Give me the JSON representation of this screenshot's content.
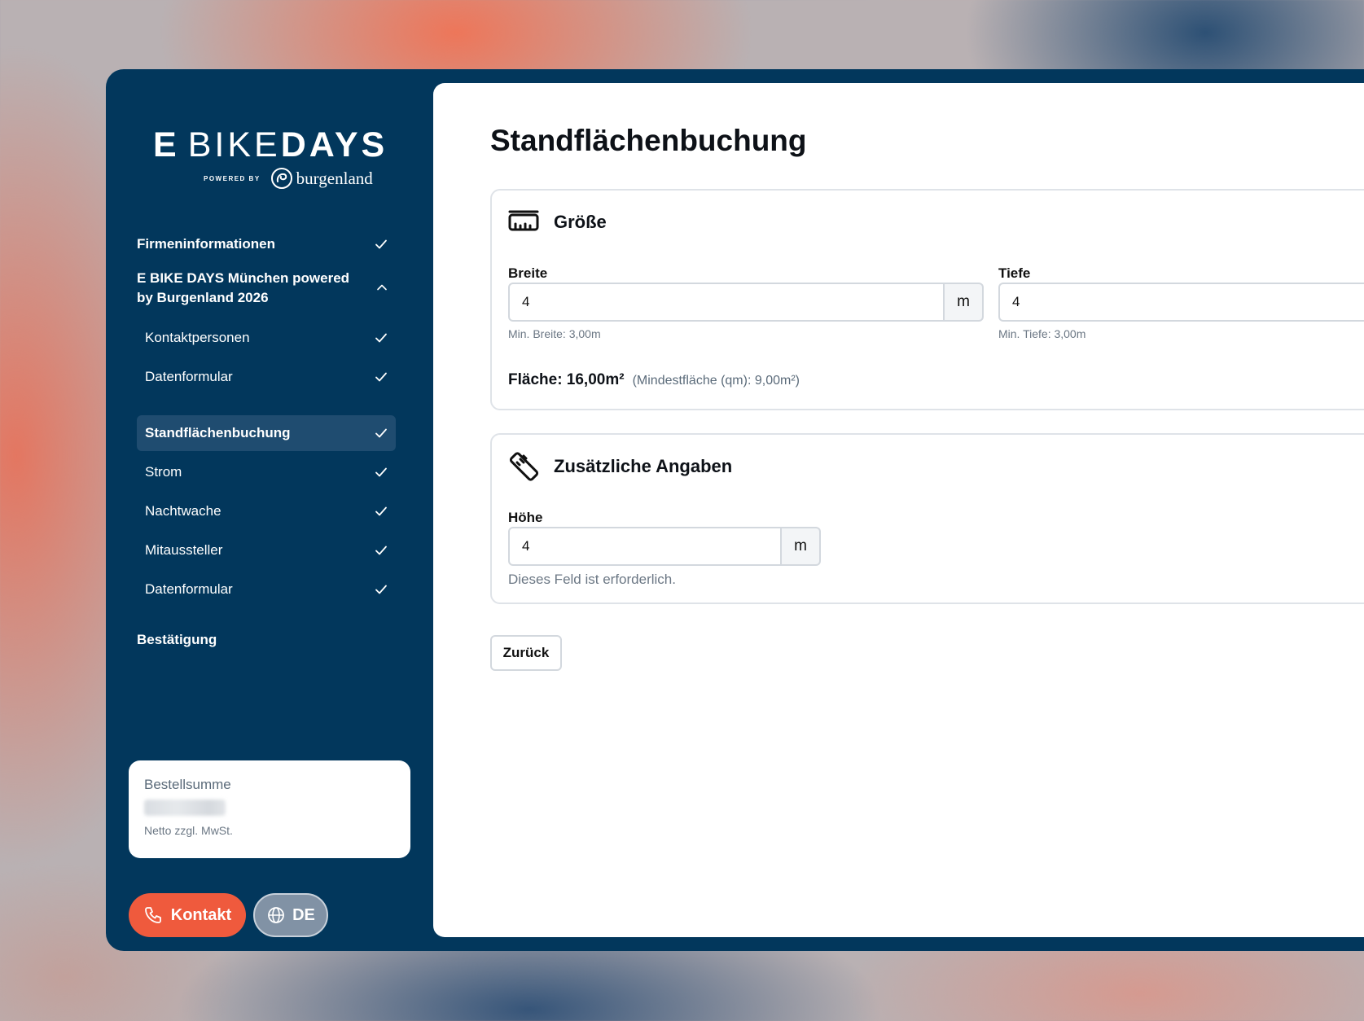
{
  "logo": {
    "word_e": "E",
    "word_bike": "BIKE",
    "word_days": "DAYS",
    "powered_by": "POWERED BY",
    "brand": "burgenland"
  },
  "nav": {
    "firmeninformationen": "Firmeninformationen",
    "event_group": "E BIKE DAYS München powered by Burgenland 2026",
    "items": [
      {
        "label": "Kontaktpersonen"
      },
      {
        "label": "Datenformular"
      },
      {
        "label": "Standflächenbuchung"
      },
      {
        "label": "Strom"
      },
      {
        "label": "Nachtwache"
      },
      {
        "label": "Mitaussteller"
      },
      {
        "label": "Datenformular"
      }
    ],
    "bestaetigung": "Bestätigung"
  },
  "summary": {
    "label": "Bestellsumme",
    "note": "Netto zzgl. MwSt."
  },
  "buttons": {
    "contact": "Kontakt",
    "language": "DE",
    "back": "Zurück"
  },
  "page": {
    "title": "Standflächenbuchung"
  },
  "size_card": {
    "title": "Größe",
    "breite_label": "Breite",
    "breite_value": "4",
    "breite_unit": "m",
    "breite_hint": "Min. Breite: 3,00m",
    "tiefe_label": "Tiefe",
    "tiefe_value": "4",
    "tiefe_hint": "Min. Tiefe: 3,00m",
    "area_main": "Fläche: 16,00m²",
    "area_sub": "(Mindestfläche (qm): 9,00m²)"
  },
  "extra_card": {
    "title": "Zusätzliche Angaben",
    "hoehe_label": "Höhe",
    "hoehe_value": "4",
    "hoehe_unit": "m",
    "hoehe_hint": "Dieses Feld ist erforderlich."
  },
  "colors": {
    "sidebar": "#02375c",
    "active_item": "#1f4c70",
    "accent": "#ef5a3d"
  }
}
